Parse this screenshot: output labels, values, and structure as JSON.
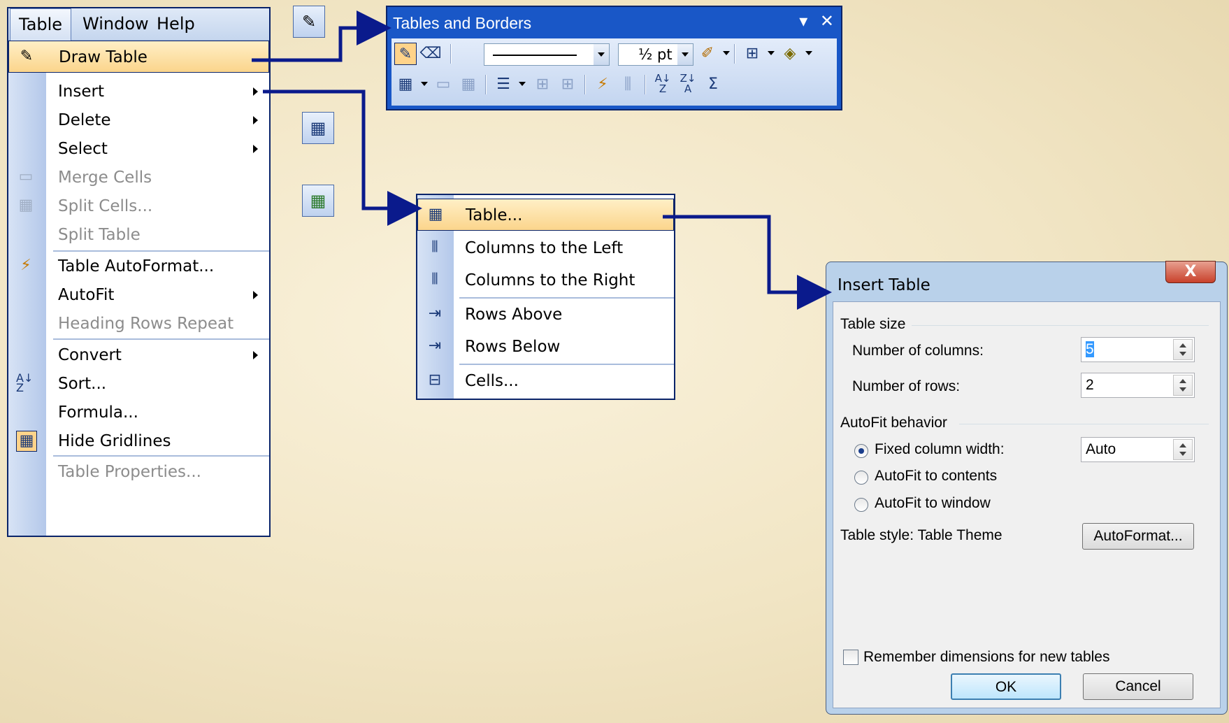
{
  "menubar": {
    "items": [
      "Table",
      "Window",
      "Help"
    ]
  },
  "table_menu": {
    "items": [
      {
        "label": "Draw Table",
        "icon": "draw-table-icon",
        "highlighted": true
      },
      {
        "label": "Insert",
        "submenu": true
      },
      {
        "label": "Delete",
        "submenu": true
      },
      {
        "label": "Select",
        "submenu": true
      },
      {
        "label": "Merge Cells",
        "icon": "merge-cells-icon",
        "disabled": true
      },
      {
        "label": "Split Cells...",
        "icon": "split-cells-icon",
        "disabled": true
      },
      {
        "label": "Split Table",
        "disabled": true
      },
      {
        "label": "Table AutoFormat...",
        "icon": "autoformat-icon"
      },
      {
        "label": "AutoFit",
        "submenu": true
      },
      {
        "label": "Heading Rows Repeat",
        "disabled": true
      },
      {
        "label": "Convert",
        "submenu": true
      },
      {
        "label": "Sort...",
        "icon": "sort-icon"
      },
      {
        "label": "Formula..."
      },
      {
        "label": "Hide Gridlines",
        "icon": "gridlines-icon"
      },
      {
        "label": "Table Properties...",
        "disabled": true
      }
    ]
  },
  "toolbar": {
    "title": "Tables and Borders",
    "line_weight": "½ pt"
  },
  "insert_menu": {
    "items": [
      {
        "label": "Table...",
        "icon": "insert-table-icon",
        "highlighted": true
      },
      {
        "label": "Columns to the Left",
        "icon": "columns-left-icon"
      },
      {
        "label": "Columns to the Right",
        "icon": "columns-right-icon"
      },
      {
        "label": "Rows Above",
        "icon": "rows-above-icon"
      },
      {
        "label": "Rows Below",
        "icon": "rows-below-icon"
      },
      {
        "label": "Cells...",
        "icon": "cells-icon"
      }
    ]
  },
  "dialog": {
    "title": "Insert Table",
    "close": "X",
    "table_size": {
      "heading": "Table size",
      "columns_label": "Number of columns:",
      "columns_value": "5",
      "rows_label": "Number of rows:",
      "rows_value": "2"
    },
    "autofit": {
      "heading": "AutoFit behavior",
      "fixed_label": "Fixed column width:",
      "fixed_value": "Auto",
      "contents_label": "AutoFit to contents",
      "window_label": "AutoFit to window",
      "selected": "Fixed column width:"
    },
    "style_label": "Table style:",
    "style_value": "Table Theme",
    "autoformat_button": "AutoFormat...",
    "remember_label": "Remember dimensions for new tables",
    "remember_checked": false,
    "ok_button": "OK",
    "cancel_button": "Cancel"
  },
  "colors": {
    "arrow": "#0a1a8c",
    "menu_highlight": "#fbd58c",
    "toolbar_title": "#1957c7"
  }
}
